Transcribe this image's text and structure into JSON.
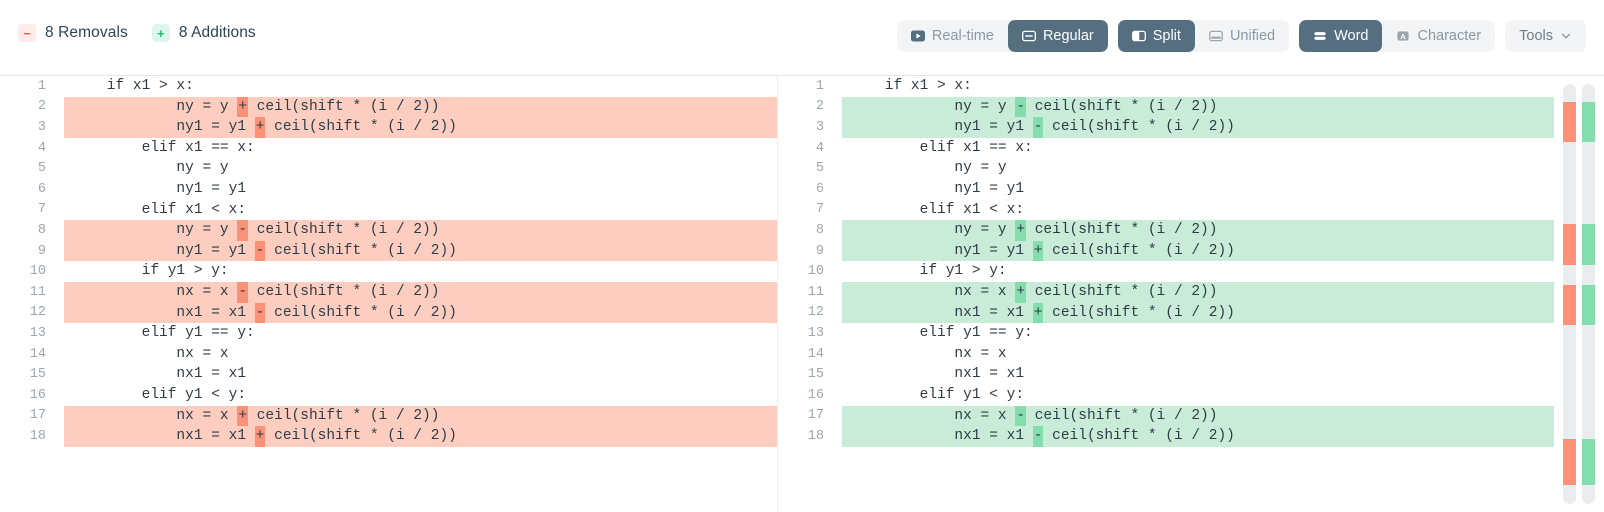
{
  "header": {
    "stats": [
      {
        "icon": "minus-icon",
        "symbol": "−",
        "label": "8 Removals",
        "type": "removals"
      },
      {
        "icon": "plus-icon",
        "symbol": "+",
        "label": "8 Additions",
        "type": "additions"
      }
    ],
    "toolbar": {
      "view_mode_group": [
        {
          "label": "Real-time",
          "icon": "play-icon",
          "active": false
        },
        {
          "label": "Regular",
          "icon": "window-icon",
          "active": true
        }
      ],
      "layout_group": [
        {
          "label": "Split",
          "icon": "split-panel-icon",
          "active": true
        },
        {
          "label": "Unified",
          "icon": "unified-panel-icon",
          "active": false
        }
      ],
      "granularity_group": [
        {
          "label": "Word",
          "icon": "stacked-bars-icon",
          "active": true
        },
        {
          "label": "Character",
          "icon": "letter-a-icon",
          "active": false
        }
      ],
      "tools": {
        "label": "Tools",
        "icon": "chevron-down-icon"
      }
    }
  },
  "colors": {
    "removal_row": "#fdcec0",
    "removal_word": "#fb9277",
    "addition_row": "#c9ecd8",
    "addition_word": "#84ddac",
    "active_button": "#556f80",
    "track": "#e9edf0"
  },
  "diff": {
    "left": {
      "lines": [
        {
          "n": "1",
          "changed": false,
          "pre": "    if x1 > x:",
          "op": "",
          "post": ""
        },
        {
          "n": "2",
          "changed": true,
          "pre": "            ny = y ",
          "op": "+",
          "post": " ceil(shift * (i / 2))"
        },
        {
          "n": "3",
          "changed": true,
          "pre": "            ny1 = y1 ",
          "op": "+",
          "post": " ceil(shift * (i / 2))"
        },
        {
          "n": "4",
          "changed": false,
          "pre": "        elif x1 == x:",
          "op": "",
          "post": ""
        },
        {
          "n": "5",
          "changed": false,
          "pre": "            ny = y",
          "op": "",
          "post": ""
        },
        {
          "n": "6",
          "changed": false,
          "pre": "            ny1 = y1",
          "op": "",
          "post": ""
        },
        {
          "n": "7",
          "changed": false,
          "pre": "        elif x1 < x:",
          "op": "",
          "post": ""
        },
        {
          "n": "8",
          "changed": true,
          "pre": "            ny = y ",
          "op": "-",
          "post": " ceil(shift * (i / 2))"
        },
        {
          "n": "9",
          "changed": true,
          "pre": "            ny1 = y1 ",
          "op": "-",
          "post": " ceil(shift * (i / 2))"
        },
        {
          "n": "10",
          "changed": false,
          "pre": "        if y1 > y:",
          "op": "",
          "post": ""
        },
        {
          "n": "11",
          "changed": true,
          "pre": "            nx = x ",
          "op": "-",
          "post": " ceil(shift * (i / 2))"
        },
        {
          "n": "12",
          "changed": true,
          "pre": "            nx1 = x1 ",
          "op": "-",
          "post": " ceil(shift * (i / 2))"
        },
        {
          "n": "13",
          "changed": false,
          "pre": "        elif y1 == y:",
          "op": "",
          "post": ""
        },
        {
          "n": "14",
          "changed": false,
          "pre": "            nx = x",
          "op": "",
          "post": ""
        },
        {
          "n": "15",
          "changed": false,
          "pre": "            nx1 = x1",
          "op": "",
          "post": ""
        },
        {
          "n": "16",
          "changed": false,
          "pre": "        elif y1 < y:",
          "op": "",
          "post": ""
        },
        {
          "n": "17",
          "changed": true,
          "pre": "            nx = x ",
          "op": "+",
          "post": " ceil(shift * (i / 2))"
        },
        {
          "n": "18",
          "changed": true,
          "pre": "            nx1 = x1 ",
          "op": "+",
          "post": " ceil(shift * (i / 2))"
        }
      ]
    },
    "right": {
      "lines": [
        {
          "n": "1",
          "changed": false,
          "pre": "    if x1 > x:",
          "op": "",
          "post": ""
        },
        {
          "n": "2",
          "changed": true,
          "pre": "            ny = y ",
          "op": "-",
          "post": " ceil(shift * (i / 2))"
        },
        {
          "n": "3",
          "changed": true,
          "pre": "            ny1 = y1 ",
          "op": "-",
          "post": " ceil(shift * (i / 2))"
        },
        {
          "n": "4",
          "changed": false,
          "pre": "        elif x1 == x:",
          "op": "",
          "post": ""
        },
        {
          "n": "5",
          "changed": false,
          "pre": "            ny = y",
          "op": "",
          "post": ""
        },
        {
          "n": "6",
          "changed": false,
          "pre": "            ny1 = y1",
          "op": "",
          "post": ""
        },
        {
          "n": "7",
          "changed": false,
          "pre": "        elif x1 < x:",
          "op": "",
          "post": ""
        },
        {
          "n": "8",
          "changed": true,
          "pre": "            ny = y ",
          "op": "+",
          "post": " ceil(shift * (i / 2))"
        },
        {
          "n": "9",
          "changed": true,
          "pre": "            ny1 = y1 ",
          "op": "+",
          "post": " ceil(shift * (i / 2))"
        },
        {
          "n": "10",
          "changed": false,
          "pre": "        if y1 > y:",
          "op": "",
          "post": ""
        },
        {
          "n": "11",
          "changed": true,
          "pre": "            nx = x ",
          "op": "+",
          "post": " ceil(shift * (i / 2))"
        },
        {
          "n": "12",
          "changed": true,
          "pre": "            nx1 = x1 ",
          "op": "+",
          "post": " ceil(shift * (i / 2))"
        },
        {
          "n": "13",
          "changed": false,
          "pre": "        elif y1 == y:",
          "op": "",
          "post": ""
        },
        {
          "n": "14",
          "changed": false,
          "pre": "            nx = x",
          "op": "",
          "post": ""
        },
        {
          "n": "15",
          "changed": false,
          "pre": "            nx1 = x1",
          "op": "",
          "post": ""
        },
        {
          "n": "16",
          "changed": false,
          "pre": "        elif y1 < y:",
          "op": "",
          "post": ""
        },
        {
          "n": "17",
          "changed": true,
          "pre": "            nx = x ",
          "op": "-",
          "post": " ceil(shift * (i / 2))"
        },
        {
          "n": "18",
          "changed": true,
          "pre": "            nx1 = x1 ",
          "op": "-",
          "post": " ceil(shift * (i / 2))"
        }
      ]
    }
  },
  "minimap": {
    "marks": [
      {
        "top_pct": 4.2,
        "height_pct": 9.6
      },
      {
        "top_pct": 33.4,
        "height_pct": 9.6
      },
      {
        "top_pct": 47.9,
        "height_pct": 9.6
      },
      {
        "top_pct": 84.5,
        "height_pct": 11.0
      }
    ]
  }
}
